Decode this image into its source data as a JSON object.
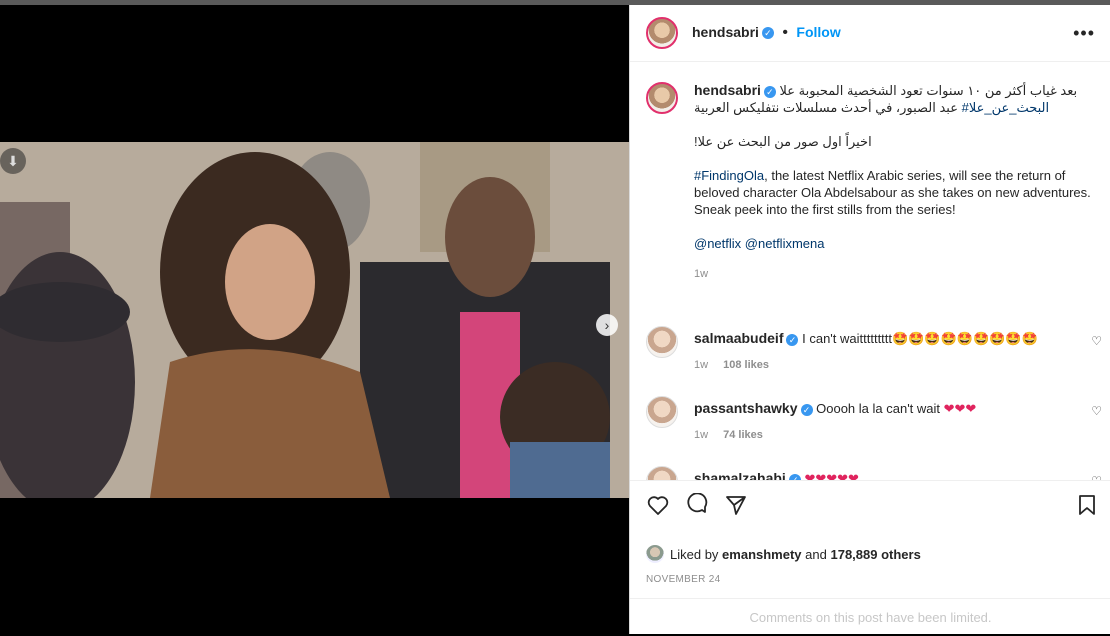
{
  "post": {
    "username": "hendsabri",
    "follow_label": "Follow",
    "more_label": "•••",
    "caption": {
      "arabic_line": "بعد غياب أكثر من ١٠ سنوات تعود الشخصية المحبوبة علا عبد الصبور، في أحدث مسلسلات نتفليكس العربية",
      "arabic_hashtag": "#البحث_عن_علا",
      "arabic_line2": "اخيراً اول صور من البحث عن علا!",
      "hashtag_en": "#FindingOla",
      "en_text": ", the latest Netflix Arabic series, will see the return of beloved character Ola Abdelsabour as she takes on new adventures.",
      "en_text2": "Sneak peek into the first stills from the series!",
      "mention1": "@netflix",
      "mention2": "@netflixmena",
      "time": "1w"
    },
    "comments": [
      {
        "user": "salmaabudeif",
        "text": "I can't waittttttttt",
        "emoji": "🤩🤩🤩🤩🤩🤩🤩🤩🤩",
        "time": "1w",
        "likes": "108 likes"
      },
      {
        "user": "passantshawky",
        "text": "Ooooh la la can't wait",
        "emoji": "❤❤❤",
        "time": "1w",
        "likes": "74 likes"
      },
      {
        "user": "shamalzahabi",
        "text": "",
        "emoji": "❤❤❤❤❤",
        "time": "",
        "likes": ""
      }
    ],
    "liked_by_prefix": "Liked by",
    "liked_by_user": "emanshmety",
    "liked_by_and": "and",
    "liked_by_count": "178,889 others",
    "date": "NOVEMBER 24",
    "comments_limited": "Comments on this post have been limited."
  },
  "carousel": {
    "dots_total": 4,
    "active_index": 0
  },
  "colors": {
    "link": "#00376b",
    "verified": "#3897f0",
    "follow": "#0095f6"
  }
}
